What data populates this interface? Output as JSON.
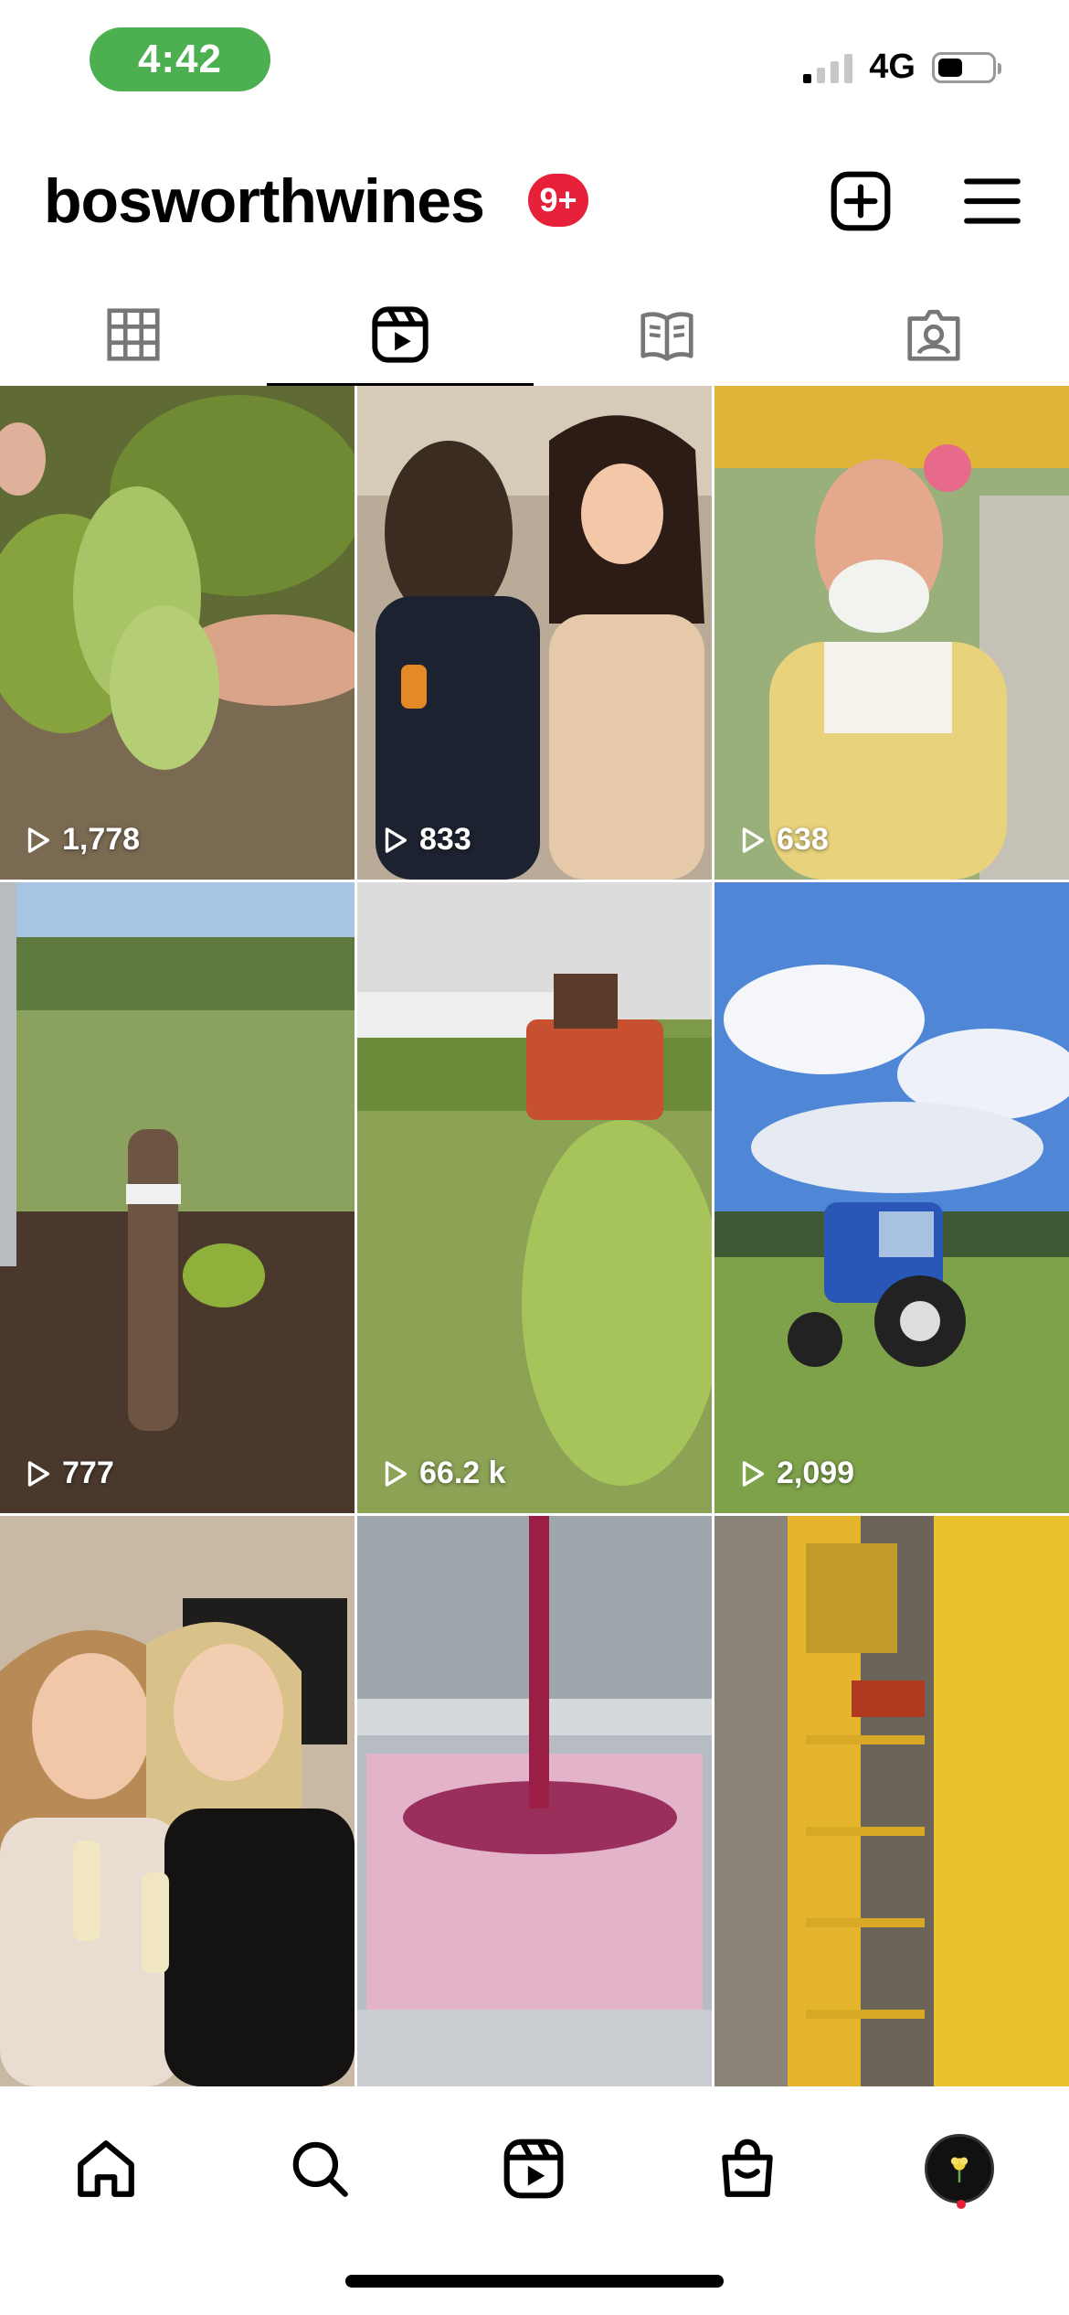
{
  "status_bar": {
    "time": "4:42",
    "network": "4G",
    "signal_bars": 4,
    "signal_bars_active": 1,
    "battery_level": 0.4,
    "time_pill_color": "#4caf50"
  },
  "header": {
    "username": "bosworthwines",
    "notification_badge": "9+",
    "create_icon": "plus-square-icon",
    "menu_icon": "hamburger-menu-icon"
  },
  "tabs": [
    {
      "icon": "grid-icon",
      "active": false
    },
    {
      "icon": "reels-icon",
      "active": true
    },
    {
      "icon": "guide-icon",
      "active": false
    },
    {
      "icon": "tagged-icon",
      "active": false
    }
  ],
  "reels": [
    {
      "views": "1,778"
    },
    {
      "views": "833"
    },
    {
      "views": "638"
    },
    {
      "views": "777"
    },
    {
      "views": "66.2 k"
    },
    {
      "views": "2,099"
    },
    {
      "views": ""
    },
    {
      "views": ""
    },
    {
      "views": ""
    }
  ],
  "bottom_nav": [
    {
      "icon": "home-icon"
    },
    {
      "icon": "search-icon"
    },
    {
      "icon": "reels-icon"
    },
    {
      "icon": "shop-icon"
    },
    {
      "icon": "profile-avatar"
    }
  ],
  "colors": {
    "badge": "#e8213a",
    "active_tab_indicator": "#000000"
  }
}
